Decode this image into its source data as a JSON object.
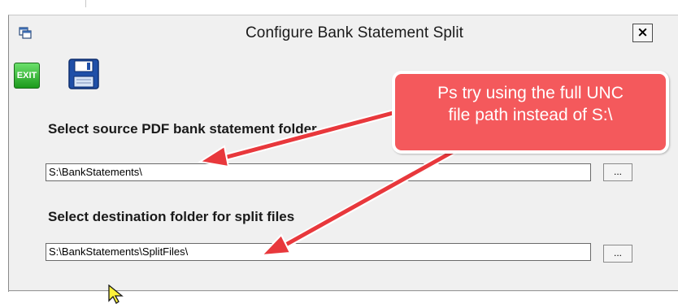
{
  "dialog": {
    "title": "Configure Bank Statement Split",
    "close_label": "×"
  },
  "toolbar": {
    "exit_label": "EXIT"
  },
  "source": {
    "label": "Select source PDF bank statement folder",
    "value": "S:\\BankStatements\\",
    "browse_label": "..."
  },
  "destination": {
    "label": "Select destination folder for split files",
    "value": "S:\\BankStatements\\SplitFiles\\",
    "browse_label": "..."
  },
  "callout": {
    "line1": "Ps try using the full UNC",
    "line2": "file path instead of S:\\"
  },
  "colors": {
    "callout": "#f4595c",
    "arrow": "#e8383c",
    "exit_green": "#1d9a1d",
    "save_blue": "#1f4fa8"
  },
  "icons": [
    "window-app-icon",
    "exit-icon",
    "floppy-save-icon",
    "mouse-cursor-icon"
  ]
}
